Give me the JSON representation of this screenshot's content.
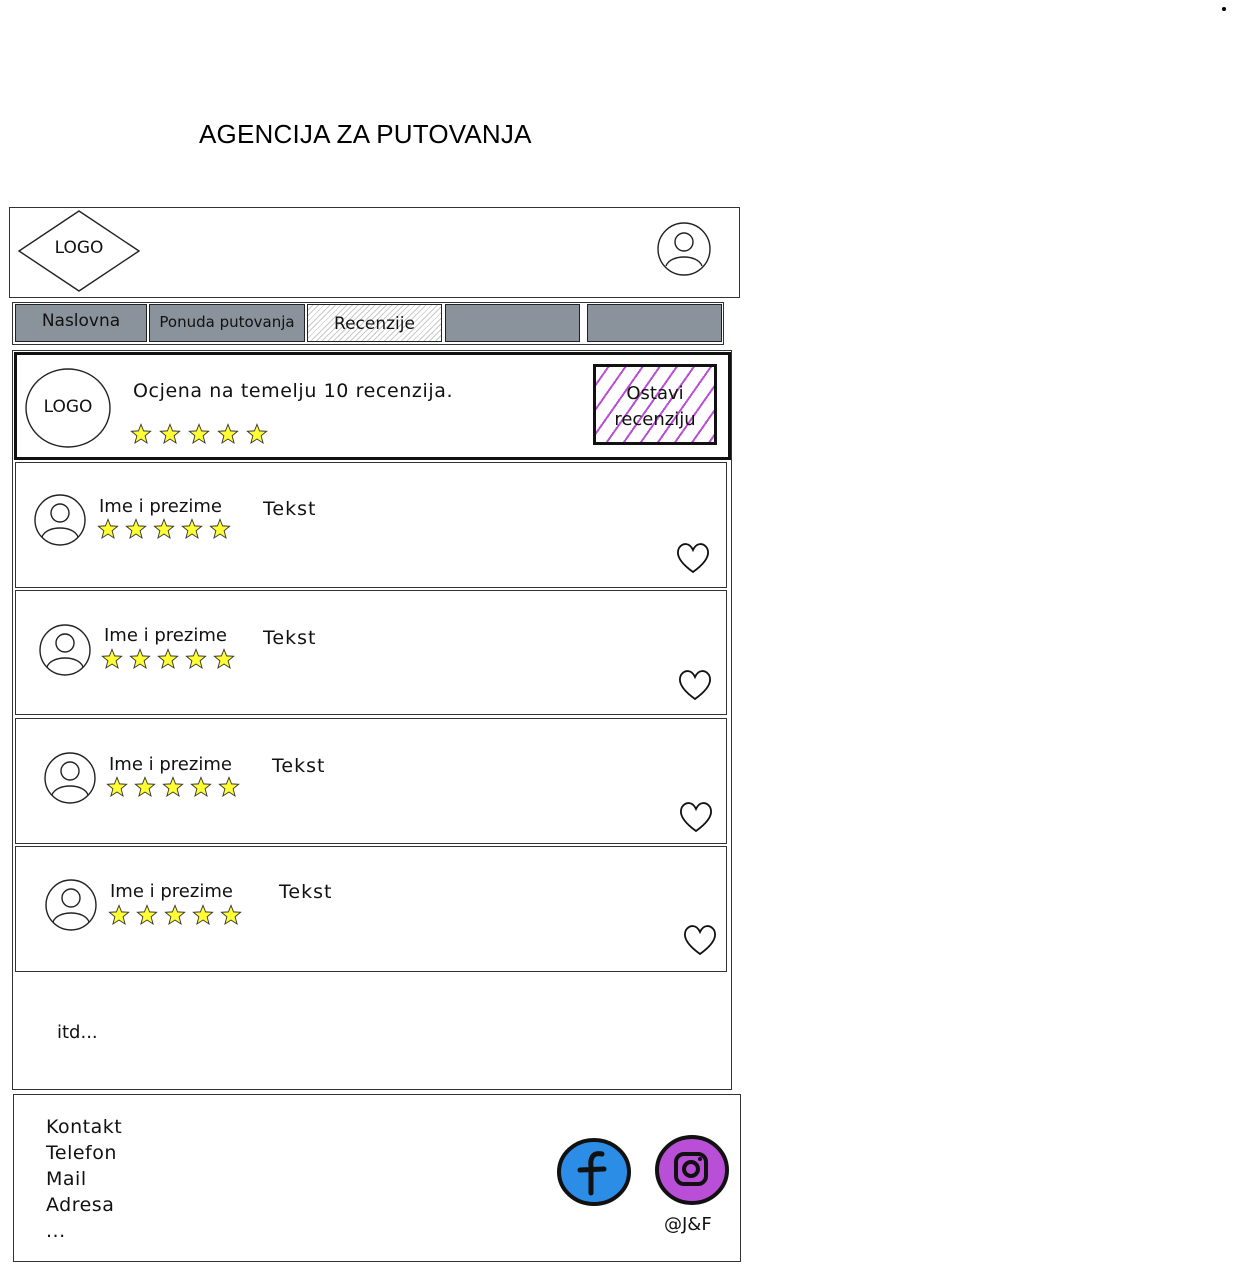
{
  "page": {
    "title": "AGENCIJA ZA PUTOVANJA"
  },
  "header": {
    "logo_label": "LOGO",
    "icons": {
      "logo": "diamond-logo",
      "profile": "user-avatar-icon"
    }
  },
  "nav": {
    "tabs": [
      {
        "label": "Naslovna",
        "active": false
      },
      {
        "label": "Ponuda putovanja",
        "active": false
      },
      {
        "label": "Recenzije",
        "active": true
      },
      {
        "label": "",
        "active": false
      },
      {
        "label": "",
        "active": false
      }
    ]
  },
  "summary": {
    "logo_label": "LOGO",
    "rating_text": "Ocjena na temelju 10 recenzija.",
    "stars": 5,
    "button_label": "Ostavi recenziju",
    "button_color": "#b84fd6"
  },
  "reviews": [
    {
      "name": "Ime i prezime",
      "text": "Tekst",
      "stars": 5,
      "icon": "heart-icon"
    },
    {
      "name": "Ime i prezime",
      "text": "Tekst",
      "stars": 5,
      "icon": "heart-icon"
    },
    {
      "name": "Ime i prezime",
      "text": "Tekst",
      "stars": 5,
      "icon": "heart-icon"
    },
    {
      "name": "Ime i prezime",
      "text": "Tekst",
      "stars": 5,
      "icon": "heart-icon"
    }
  ],
  "more_text": "itd...",
  "footer": {
    "lines": [
      "Kontakt",
      "Telefon",
      "Mail",
      "Adresa",
      "..."
    ],
    "copyright": "@J&F",
    "social": [
      {
        "name": "facebook-icon",
        "color": "#2b8de6"
      },
      {
        "name": "instagram-icon",
        "color": "#b84fd6"
      }
    ]
  },
  "colors": {
    "star_fill": "#ffff33",
    "nav_bg": "#8a939b"
  }
}
